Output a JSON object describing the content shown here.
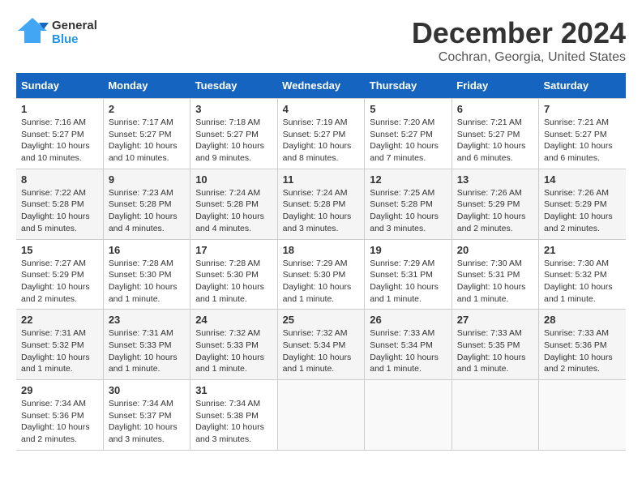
{
  "header": {
    "logo_general": "General",
    "logo_blue": "Blue",
    "month": "December 2024",
    "location": "Cochran, Georgia, United States"
  },
  "days_of_week": [
    "Sunday",
    "Monday",
    "Tuesday",
    "Wednesday",
    "Thursday",
    "Friday",
    "Saturday"
  ],
  "weeks": [
    [
      {
        "day": "1",
        "info": "Sunrise: 7:16 AM\nSunset: 5:27 PM\nDaylight: 10 hours and 10 minutes."
      },
      {
        "day": "2",
        "info": "Sunrise: 7:17 AM\nSunset: 5:27 PM\nDaylight: 10 hours and 10 minutes."
      },
      {
        "day": "3",
        "info": "Sunrise: 7:18 AM\nSunset: 5:27 PM\nDaylight: 10 hours and 9 minutes."
      },
      {
        "day": "4",
        "info": "Sunrise: 7:19 AM\nSunset: 5:27 PM\nDaylight: 10 hours and 8 minutes."
      },
      {
        "day": "5",
        "info": "Sunrise: 7:20 AM\nSunset: 5:27 PM\nDaylight: 10 hours and 7 minutes."
      },
      {
        "day": "6",
        "info": "Sunrise: 7:21 AM\nSunset: 5:27 PM\nDaylight: 10 hours and 6 minutes."
      },
      {
        "day": "7",
        "info": "Sunrise: 7:21 AM\nSunset: 5:27 PM\nDaylight: 10 hours and 6 minutes."
      }
    ],
    [
      {
        "day": "8",
        "info": "Sunrise: 7:22 AM\nSunset: 5:28 PM\nDaylight: 10 hours and 5 minutes."
      },
      {
        "day": "9",
        "info": "Sunrise: 7:23 AM\nSunset: 5:28 PM\nDaylight: 10 hours and 4 minutes."
      },
      {
        "day": "10",
        "info": "Sunrise: 7:24 AM\nSunset: 5:28 PM\nDaylight: 10 hours and 4 minutes."
      },
      {
        "day": "11",
        "info": "Sunrise: 7:24 AM\nSunset: 5:28 PM\nDaylight: 10 hours and 3 minutes."
      },
      {
        "day": "12",
        "info": "Sunrise: 7:25 AM\nSunset: 5:28 PM\nDaylight: 10 hours and 3 minutes."
      },
      {
        "day": "13",
        "info": "Sunrise: 7:26 AM\nSunset: 5:29 PM\nDaylight: 10 hours and 2 minutes."
      },
      {
        "day": "14",
        "info": "Sunrise: 7:26 AM\nSunset: 5:29 PM\nDaylight: 10 hours and 2 minutes."
      }
    ],
    [
      {
        "day": "15",
        "info": "Sunrise: 7:27 AM\nSunset: 5:29 PM\nDaylight: 10 hours and 2 minutes."
      },
      {
        "day": "16",
        "info": "Sunrise: 7:28 AM\nSunset: 5:30 PM\nDaylight: 10 hours and 1 minute."
      },
      {
        "day": "17",
        "info": "Sunrise: 7:28 AM\nSunset: 5:30 PM\nDaylight: 10 hours and 1 minute."
      },
      {
        "day": "18",
        "info": "Sunrise: 7:29 AM\nSunset: 5:30 PM\nDaylight: 10 hours and 1 minute."
      },
      {
        "day": "19",
        "info": "Sunrise: 7:29 AM\nSunset: 5:31 PM\nDaylight: 10 hours and 1 minute."
      },
      {
        "day": "20",
        "info": "Sunrise: 7:30 AM\nSunset: 5:31 PM\nDaylight: 10 hours and 1 minute."
      },
      {
        "day": "21",
        "info": "Sunrise: 7:30 AM\nSunset: 5:32 PM\nDaylight: 10 hours and 1 minute."
      }
    ],
    [
      {
        "day": "22",
        "info": "Sunrise: 7:31 AM\nSunset: 5:32 PM\nDaylight: 10 hours and 1 minute."
      },
      {
        "day": "23",
        "info": "Sunrise: 7:31 AM\nSunset: 5:33 PM\nDaylight: 10 hours and 1 minute."
      },
      {
        "day": "24",
        "info": "Sunrise: 7:32 AM\nSunset: 5:33 PM\nDaylight: 10 hours and 1 minute."
      },
      {
        "day": "25",
        "info": "Sunrise: 7:32 AM\nSunset: 5:34 PM\nDaylight: 10 hours and 1 minute."
      },
      {
        "day": "26",
        "info": "Sunrise: 7:33 AM\nSunset: 5:34 PM\nDaylight: 10 hours and 1 minute."
      },
      {
        "day": "27",
        "info": "Sunrise: 7:33 AM\nSunset: 5:35 PM\nDaylight: 10 hours and 1 minute."
      },
      {
        "day": "28",
        "info": "Sunrise: 7:33 AM\nSunset: 5:36 PM\nDaylight: 10 hours and 2 minutes."
      }
    ],
    [
      {
        "day": "29",
        "info": "Sunrise: 7:34 AM\nSunset: 5:36 PM\nDaylight: 10 hours and 2 minutes."
      },
      {
        "day": "30",
        "info": "Sunrise: 7:34 AM\nSunset: 5:37 PM\nDaylight: 10 hours and 3 minutes."
      },
      {
        "day": "31",
        "info": "Sunrise: 7:34 AM\nSunset: 5:38 PM\nDaylight: 10 hours and 3 minutes."
      },
      {
        "day": "",
        "info": ""
      },
      {
        "day": "",
        "info": ""
      },
      {
        "day": "",
        "info": ""
      },
      {
        "day": "",
        "info": ""
      }
    ]
  ]
}
